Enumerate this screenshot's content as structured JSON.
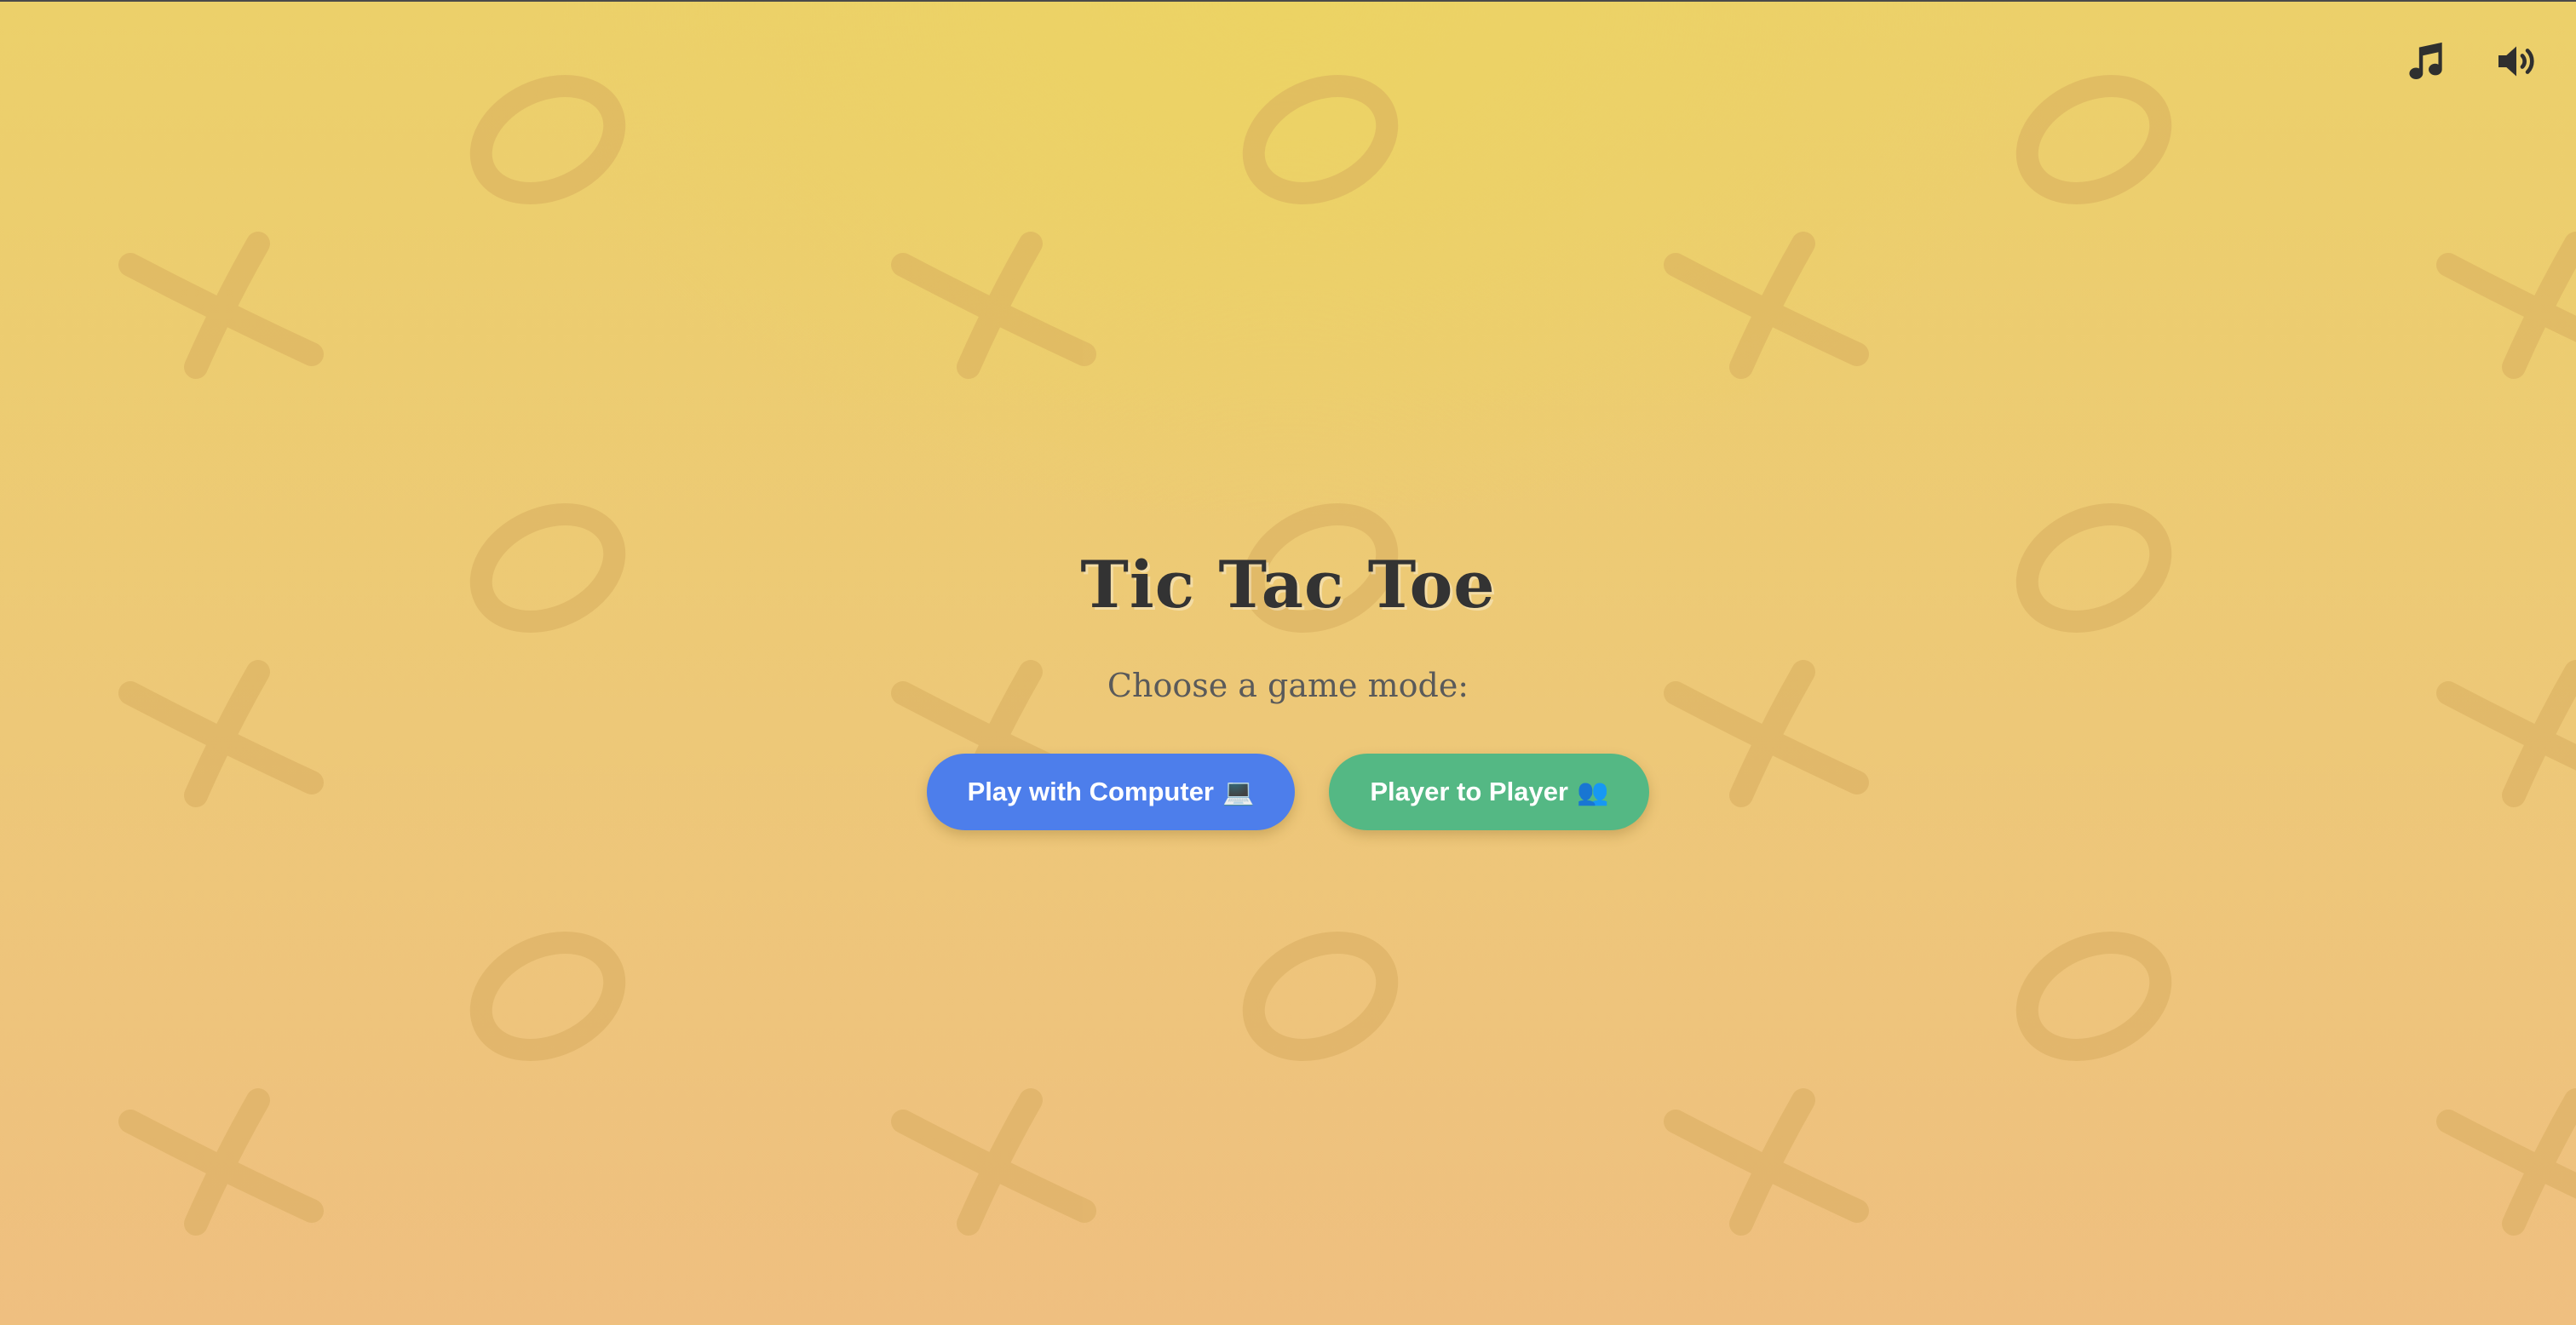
{
  "title": "Tic Tac Toe",
  "subtitle": "Choose a game mode:",
  "buttons": {
    "computer": {
      "label": "Play with Computer",
      "emoji": "💻",
      "color": "#4d7eeb"
    },
    "player": {
      "label": "Player to Player",
      "emoji": "👥",
      "color": "#54b884"
    }
  },
  "icons": {
    "music": "music-icon",
    "sound": "volume-icon"
  },
  "colors": {
    "background_top": "#ecd06a",
    "background_bottom": "#efbf80",
    "pattern_mark": "#d4a85a",
    "title": "#333333"
  }
}
